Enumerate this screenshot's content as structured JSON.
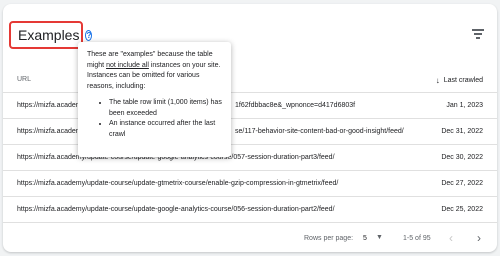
{
  "header": {
    "title": "Examples",
    "help_glyph": "?"
  },
  "table": {
    "columns": {
      "url": "URL",
      "last_crawled": "Last crawled"
    },
    "rows": [
      {
        "url": "https://mizfa.academ",
        "url_tail": "1f62fdbbac8e&_wpnonce=d417d6803f",
        "date": "Jan 1, 2023"
      },
      {
        "url": "https://mizfa.academ",
        "url_tail": "se/117-behavior-site-content-bad-or-good-insight/feed/",
        "date": "Dec 31, 2022"
      },
      {
        "url": "https://mizfa.academy/update-course/update-google-analytics-course/057-session-duration-part3/feed/",
        "url_tail": "",
        "date": "Dec 30, 2022"
      },
      {
        "url": "https://mizfa.academy/update-course/update-gtmetrix-course/enable-gzip-compression-in-gtmetrix/feed/",
        "url_tail": "",
        "date": "Dec 27, 2022"
      },
      {
        "url": "https://mizfa.academy/update-course/update-google-analytics-course/056-session-duration-part2/feed/",
        "url_tail": "",
        "date": "Dec 25, 2022"
      }
    ]
  },
  "footer": {
    "rows_per_page_label": "Rows per page:",
    "rows_per_page_value": "5",
    "range": "1-5 of 95"
  },
  "tooltip": {
    "line1": "These are \"examples\" because the table",
    "line2_pre": "might ",
    "line2_ul": "not include all",
    "line2_post": " instances on your site.",
    "line3": "Instances can be omitted for various",
    "line4": "reasons, including:",
    "bullets": [
      "The table row limit (1,000 items) has been exceeded",
      "An instance occurred after the last crawl"
    ]
  },
  "colors": {
    "highlight_border": "#e53935",
    "accent": "#1a73e8"
  },
  "icons": [
    "help-icon",
    "filter-icon",
    "sort-arrow-down-icon",
    "dropdown-arrow-icon",
    "chevron-left-icon",
    "chevron-right-icon"
  ]
}
